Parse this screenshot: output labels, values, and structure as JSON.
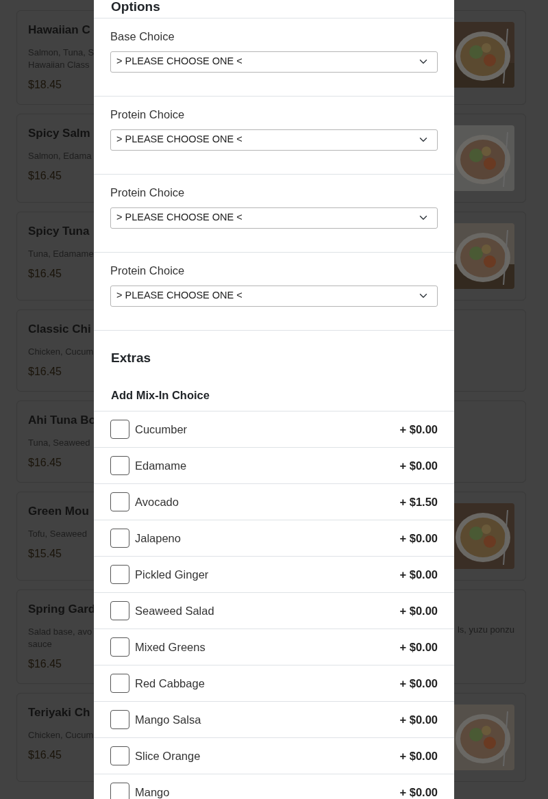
{
  "menu_cards": [
    {
      "title": "Hawaiian C",
      "lines": [
        {
          "text": "Salmon, Tuna, S"
        },
        {
          "text": "Hawaiian Class"
        }
      ],
      "price": "$18.45",
      "image": {
        "kind": "picture"
      }
    },
    {
      "title": "Spicy Salm",
      "lines": [
        {
          "text": "Salmon, Edama"
        }
      ],
      "price": "$16.45",
      "image": {
        "kind": "picture"
      }
    },
    {
      "title": "Spicy Tuna",
      "lines": [
        {
          "text": "Tuna, Edamame"
        }
      ],
      "price": "$16.45",
      "image": {
        "kind": "picture"
      }
    },
    {
      "title": "Classic Chi",
      "lines": [
        {
          "text": "Chicken, Cucum"
        }
      ],
      "price": "$16.45"
    },
    {
      "title": "Ahi Tuna Bo",
      "lines": [
        {
          "text": "Tuna, Seaweed"
        }
      ],
      "price": "$16.45"
    },
    {
      "title": "Green Mou",
      "lines": [
        {
          "text": "Tofu, Seaweed"
        }
      ],
      "price": "$15.45",
      "image": {
        "kind": "picture"
      }
    },
    {
      "title": "Spring Gard",
      "lines": [
        {
          "text": "Salad base, avo",
          "tail": "ls, yuzu ponzu"
        },
        {
          "text": "sauce"
        }
      ],
      "price": "$16.45"
    },
    {
      "title": "Teriyaki Ch",
      "lines": [
        {
          "text": "Chicken, Cucum"
        }
      ],
      "price": "$16.45",
      "image": {
        "kind": "picture"
      }
    }
  ],
  "modal": {
    "options_title": "Options",
    "choices": [
      {
        "label": "Base Choice",
        "value": "> PLEASE CHOOSE ONE <"
      },
      {
        "label": "Protein Choice",
        "value": "> PLEASE CHOOSE ONE <"
      },
      {
        "label": "Protein Choice",
        "value": "> PLEASE CHOOSE ONE <"
      },
      {
        "label": "Protein Choice",
        "value": "> PLEASE CHOOSE ONE <"
      }
    ],
    "extras_title": "Extras",
    "extras_group": "Add Mix-In Choice",
    "extras": [
      {
        "name": "Cucumber",
        "price": "+ $0.00",
        "checked": false
      },
      {
        "name": "Edamame",
        "price": "+ $0.00",
        "checked": false
      },
      {
        "name": "Avocado",
        "price": "+ $1.50",
        "checked": false
      },
      {
        "name": "Jalapeno",
        "price": "+ $0.00",
        "checked": false
      },
      {
        "name": "Pickled Ginger",
        "price": "+ $0.00",
        "checked": false
      },
      {
        "name": "Seaweed Salad",
        "price": "+ $0.00",
        "checked": false
      },
      {
        "name": "Mixed Greens",
        "price": "+ $0.00",
        "checked": false
      },
      {
        "name": "Red Cabbage",
        "price": "+ $0.00",
        "checked": false
      },
      {
        "name": "Mango Salsa",
        "price": "+ $0.00",
        "checked": false
      },
      {
        "name": "Slice Orange",
        "price": "+ $0.00",
        "checked": false
      },
      {
        "name": "Mango",
        "price": "+ $0.00",
        "checked": false
      }
    ]
  }
}
